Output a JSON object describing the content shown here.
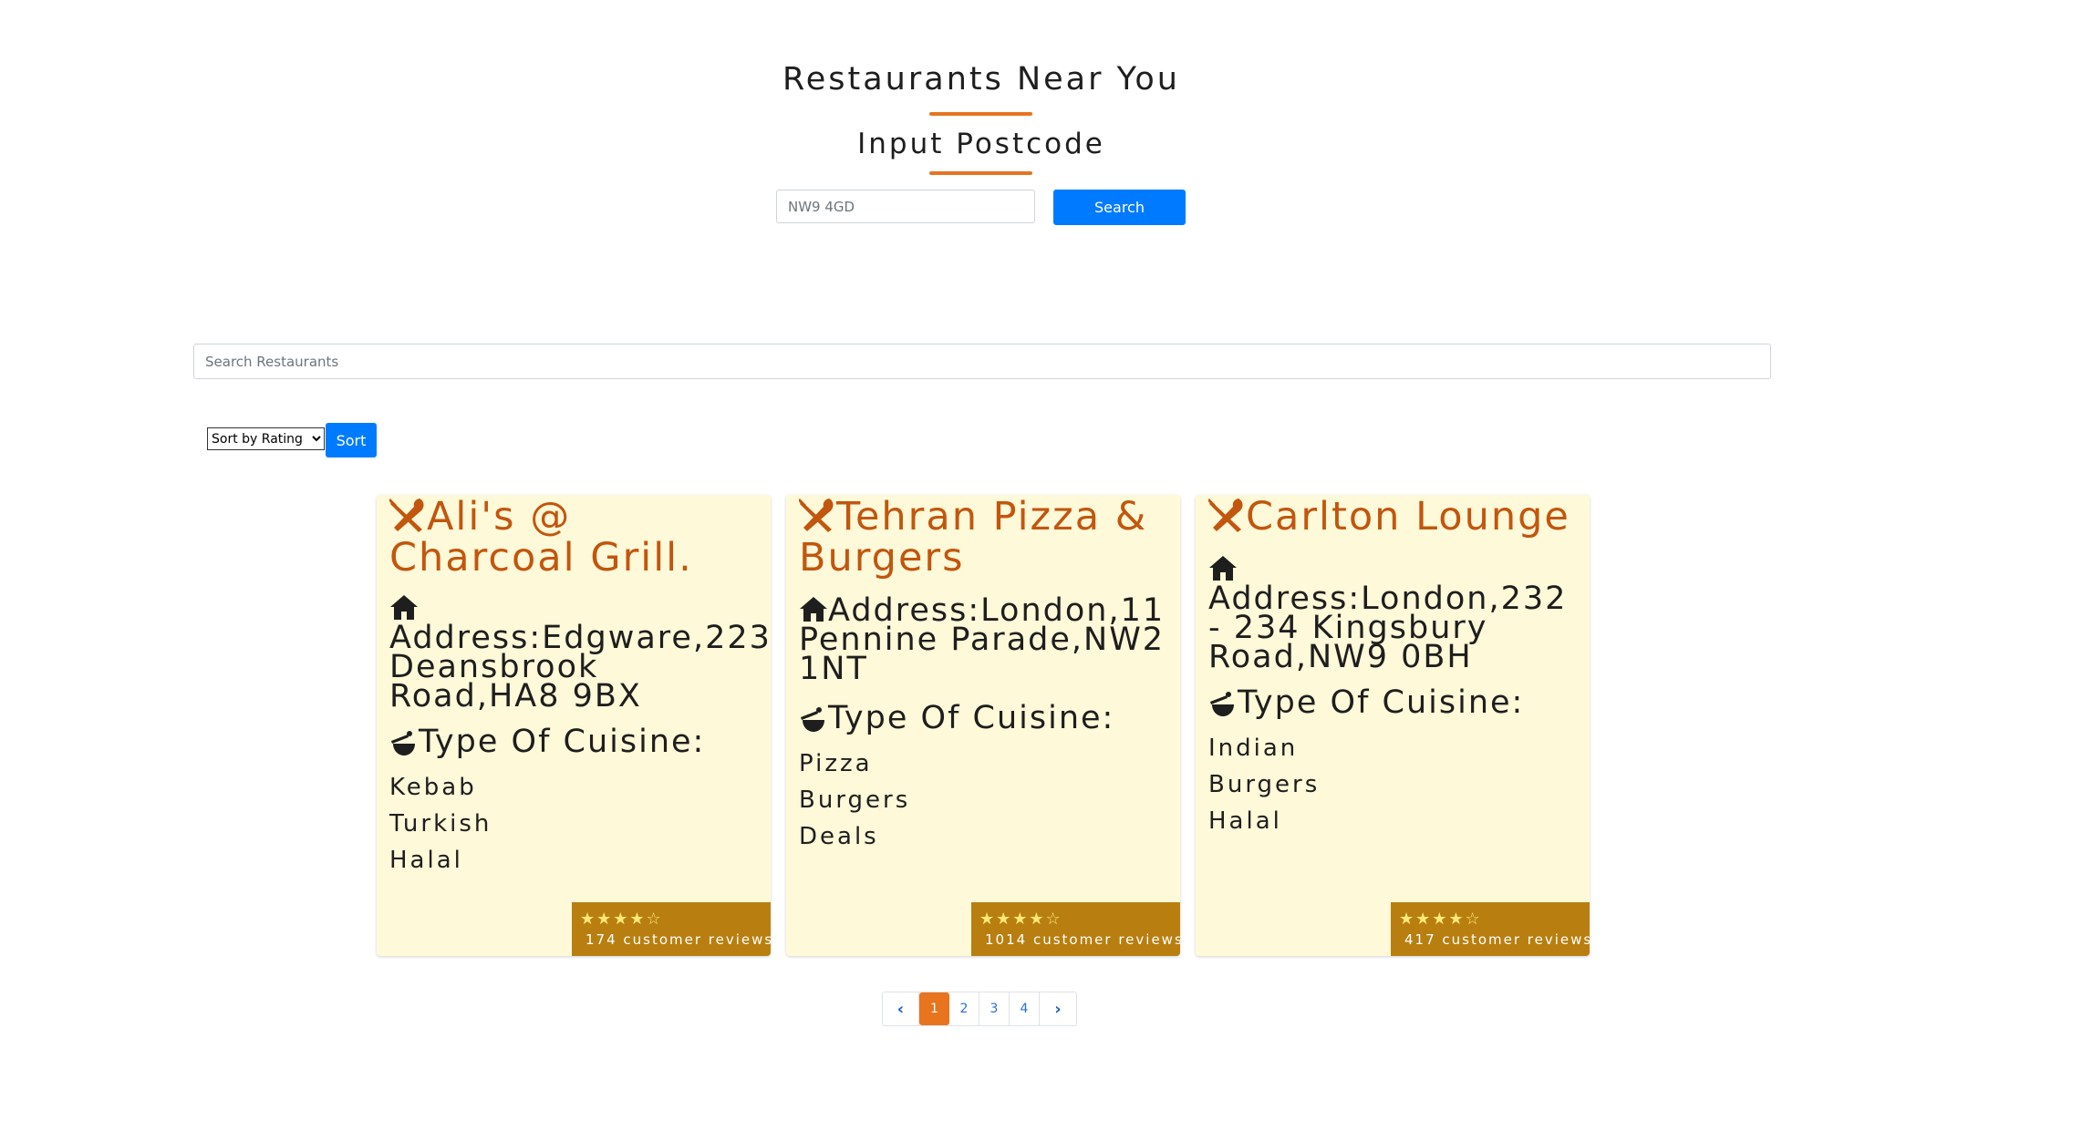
{
  "header": {
    "title": "Restaurants Near You",
    "subtitle": "Input Postcode"
  },
  "postcode_search": {
    "placeholder": "NW9 4GD",
    "button_label": "Search"
  },
  "restaurant_search": {
    "placeholder": "Search Restaurants"
  },
  "sort": {
    "selected_option": "Sort by Rating",
    "button_label": "Sort"
  },
  "cards": [
    {
      "name": "Ali's @ Charcoal Grill.",
      "address": "Address:Edgware,223 Deansbrook Road,HA8 9BX",
      "cuisine_heading": "Type Of Cuisine:",
      "cuisines": [
        "Kebab",
        "Turkish",
        "Halal"
      ],
      "rating_stars": 4,
      "reviews": "174 customer reviews"
    },
    {
      "name": "Tehran Pizza & Burgers",
      "address": "Address:London,11 Pennine Parade,NW2 1NT",
      "cuisine_heading": "Type Of Cuisine:",
      "cuisines": [
        "Pizza",
        "Burgers",
        "Deals"
      ],
      "rating_stars": 4,
      "reviews": "1014 customer reviews"
    },
    {
      "name": "Carlton Lounge",
      "address": "Address:London,232 - 234 Kingsbury Road,NW9 0BH",
      "cuisine_heading": "Type Of Cuisine:",
      "cuisines": [
        "Indian",
        "Burgers",
        "Halal"
      ],
      "rating_stars": 4,
      "reviews": "417 customer reviews"
    }
  ],
  "stars_text": "★★★★☆",
  "pagination": {
    "prev": "‹",
    "pages": [
      "1",
      "2",
      "3",
      "4"
    ],
    "active_page": "1",
    "next": "›"
  },
  "colors": {
    "accent": "#e67422",
    "title": "#c2560e",
    "card_bg": "#fef9d8",
    "badge_bg": "#b87f10",
    "primary": "#007bff"
  },
  "icons": {
    "restaurant_name": "cutlery-icon",
    "address": "house-icon",
    "cuisine": "cooking-pot-icon"
  }
}
